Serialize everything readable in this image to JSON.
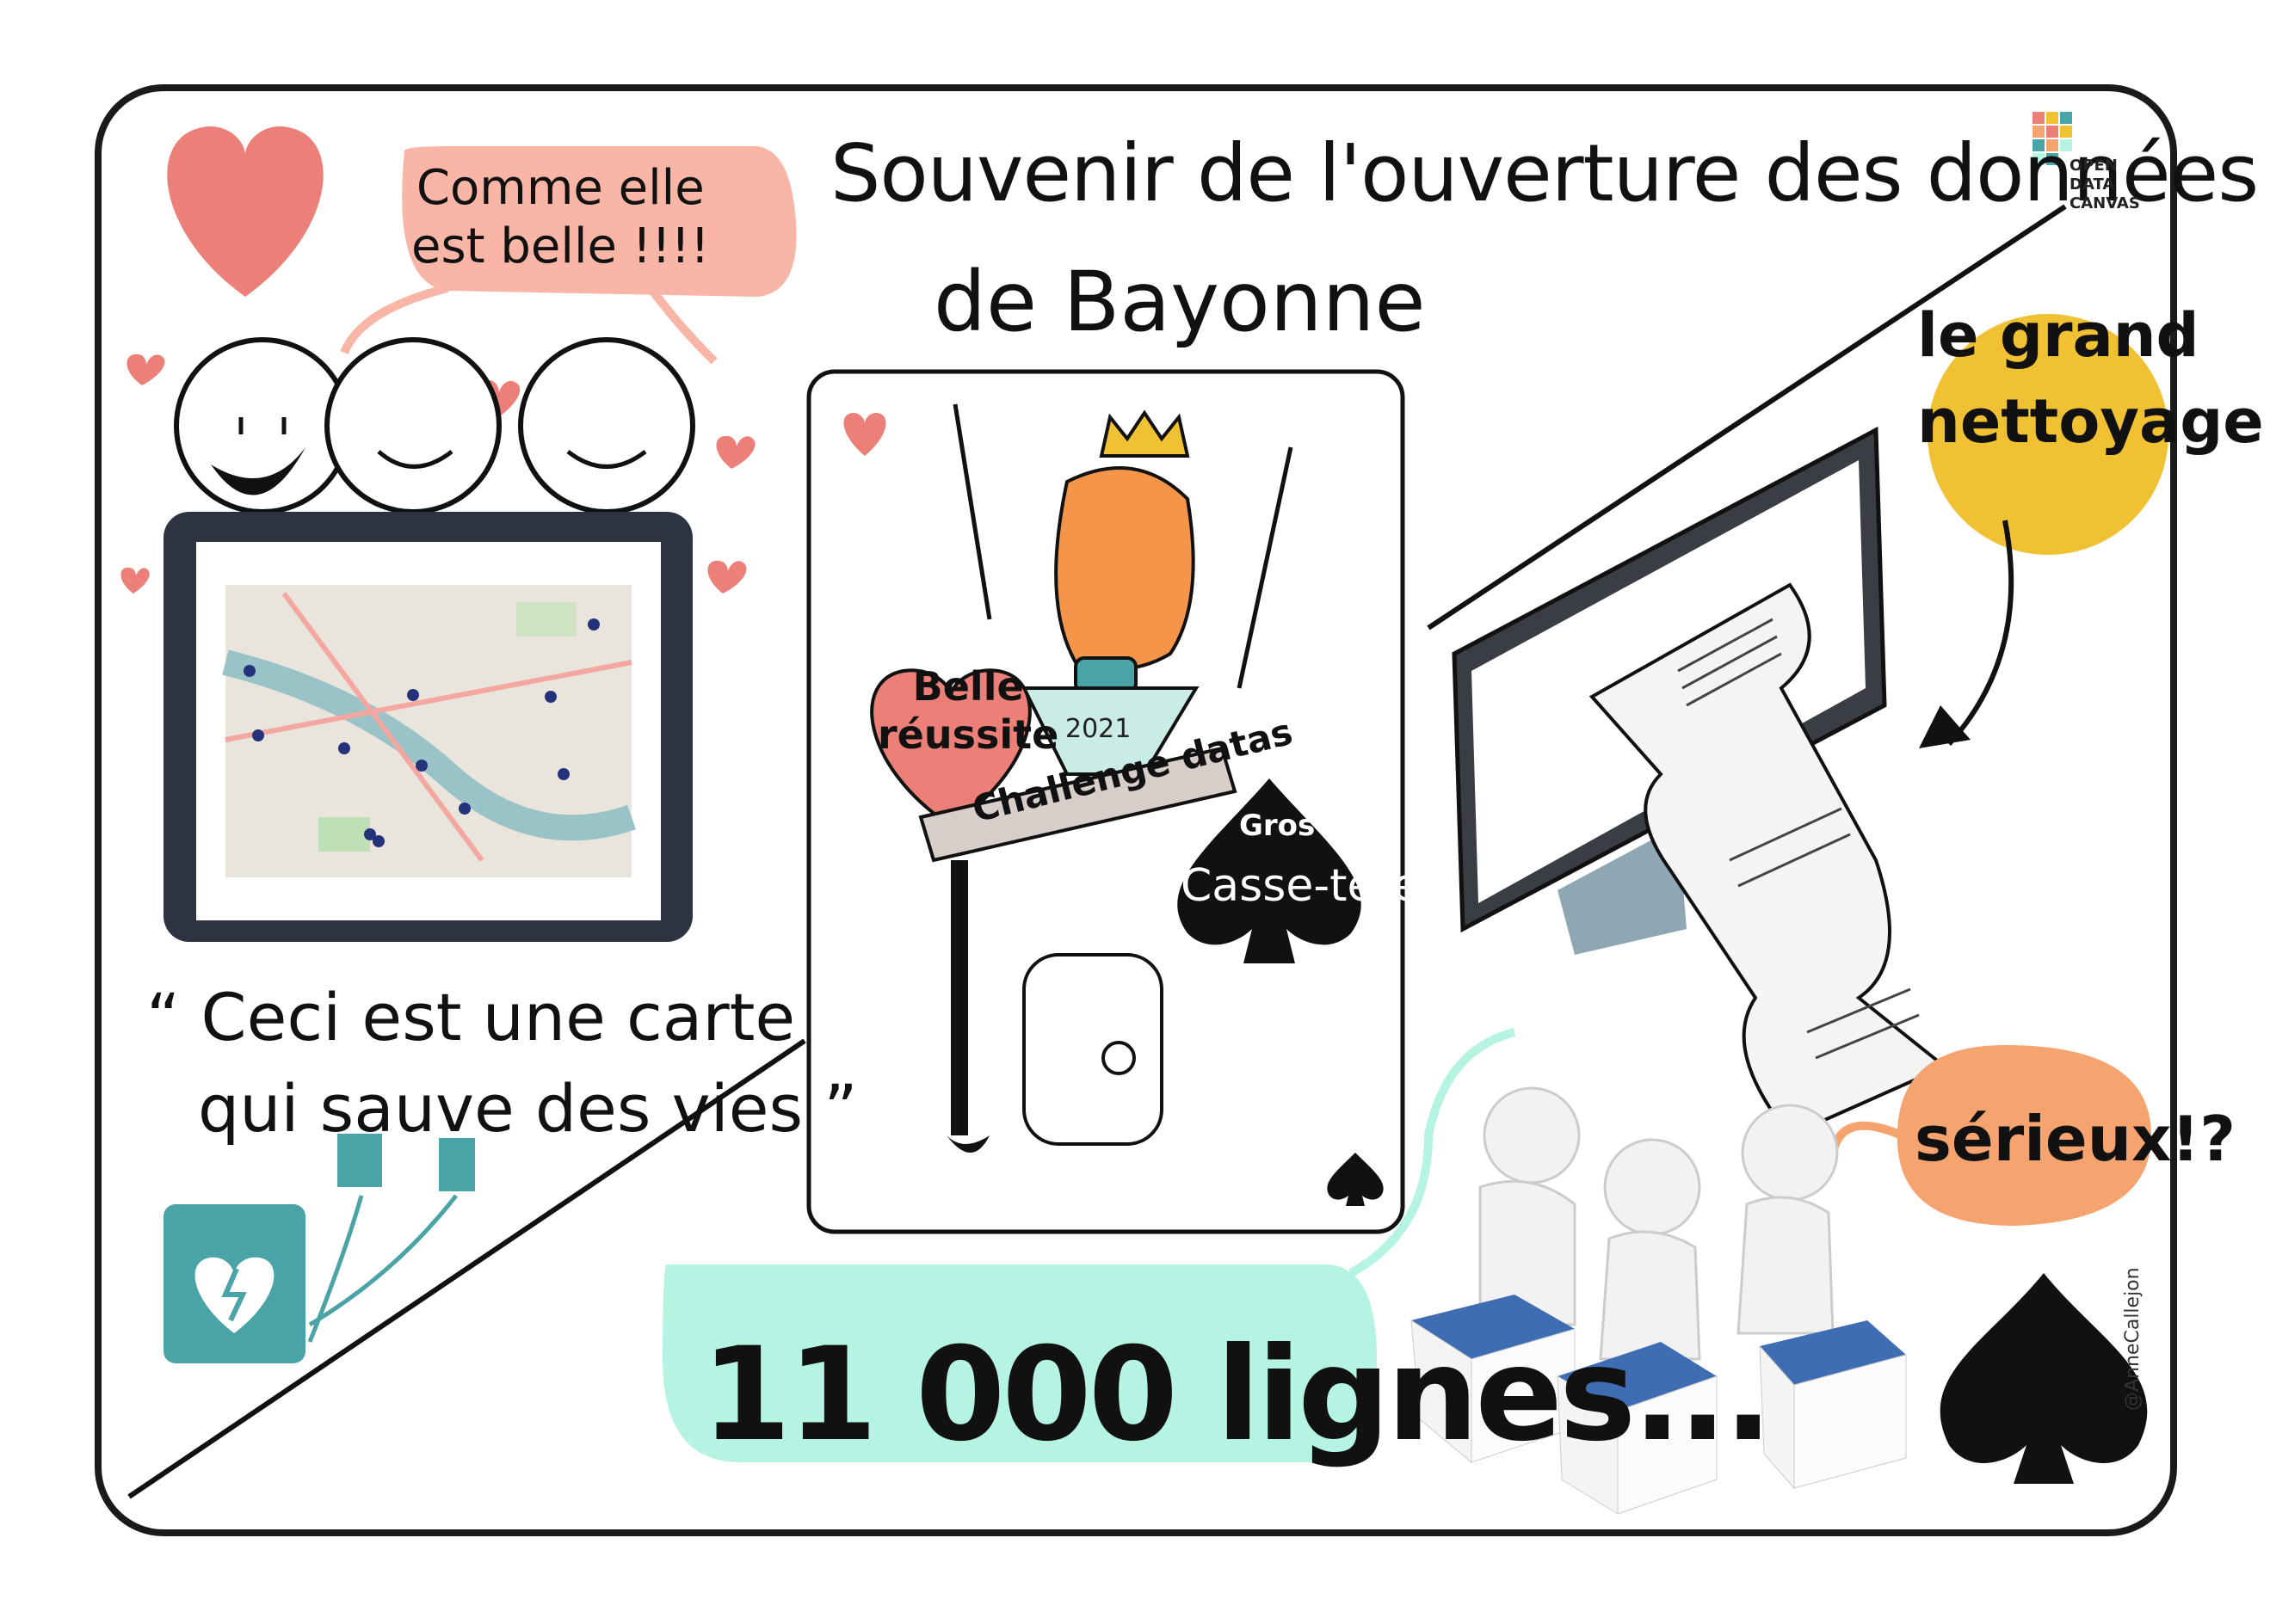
{
  "title": {
    "line1": "Souvenir de l'ouverture des données",
    "line2": "de Bayonne"
  },
  "bubbles": {
    "comme_line1": "Comme elle",
    "comme_line2": "est belle !!!!",
    "quote_line1": "Ceci est une carte",
    "quote_line2": "qui sauve des vies",
    "quote_open": "“",
    "quote_close": "”",
    "grand_line1": "le grand",
    "grand_line2": "nettoyage",
    "serieux": "sérieux!?",
    "lignes": "11 000 lignes..."
  },
  "card": {
    "belle_line1": "Belle",
    "belle_line2": "réussite",
    "year": "2021",
    "challenge": "Challenge datas",
    "gros": "Gros",
    "casse": "Casse-tête"
  },
  "logo": {
    "line1": "OPEN",
    "line2": "DATA",
    "line3": "CANVAS"
  },
  "credit": "@AnneCallejon",
  "colors": {
    "heart": "#ec8078",
    "speech_pink": "#f9b6a6",
    "speech_orange": "#f6a46f",
    "mint": "#b5f4e3",
    "yellow": "#f0c233",
    "teal_defib": "#4aa3a6",
    "frame_dark": "#2d3340",
    "seat_blue": "#3f6db3"
  },
  "icons": [
    "heart-icon",
    "spade-icon",
    "defibrillator-icon",
    "monitor-icon",
    "map-image"
  ]
}
